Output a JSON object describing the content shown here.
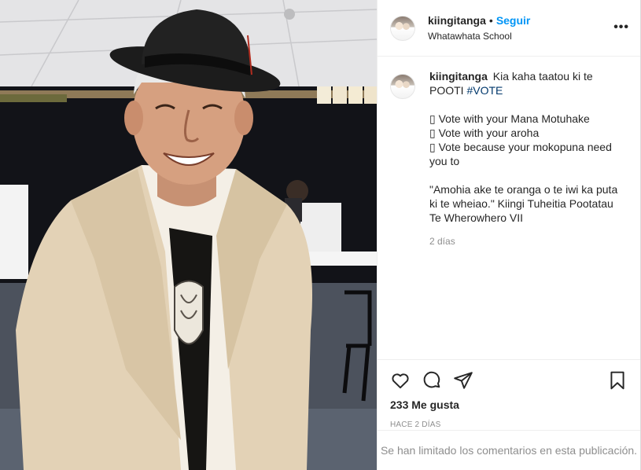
{
  "post": {
    "image_alt": "Older man in a black hat and cream jacket smiling inside a voting hall",
    "header": {
      "username": "kiingitanga",
      "follow_label": "Seguir",
      "location": "Whatawhata School",
      "more_icon": "more-options-icon"
    },
    "caption": {
      "username": "kiingitanga",
      "text_start": "Kia kaha taatou ki te POOTI",
      "hashtag": "#VOTE",
      "lines": [
        "Vote with your Mana Motuhake",
        "Vote with your aroha",
        "Vote because your mokopuna need you to"
      ],
      "bullet": "▯",
      "quote": "\"Amohia ake te oranga o te iwi ka puta ki te wheiao.\" Kiingi Tuheitia Pootatau Te Wherowhero VII",
      "time": "2 días"
    },
    "actions": {
      "like_icon": "heart-icon",
      "comment_icon": "comment-icon",
      "share_icon": "share-icon",
      "save_icon": "bookmark-icon",
      "likes": "233 Me gusta",
      "date": "HACE 2 DÍAS"
    },
    "comments_limited": "Se han limitado los comentarios en esta publicación."
  }
}
